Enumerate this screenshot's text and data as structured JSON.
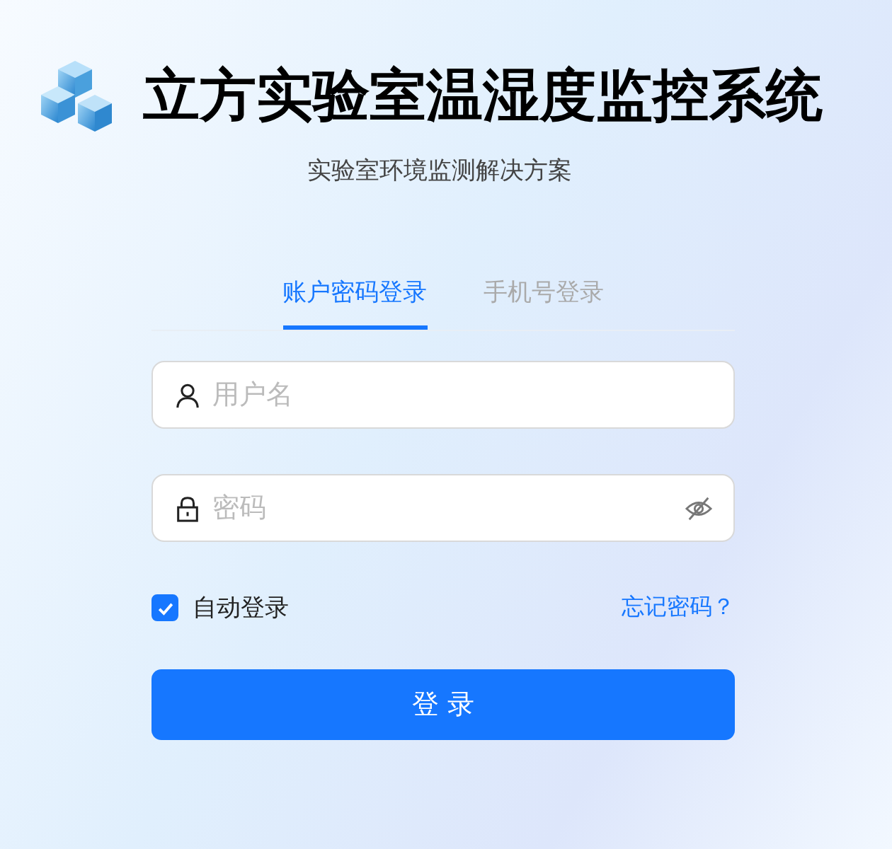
{
  "header": {
    "title": "立方实验室温湿度监控系统",
    "subtitle": "实验室环境监测解决方案"
  },
  "tabs": [
    {
      "label": "账户密码登录",
      "selected": true
    },
    {
      "label": "手机号登录",
      "selected": false
    }
  ],
  "fields": [
    {
      "kind": "username",
      "placeholder": "用户名"
    },
    {
      "kind": "password",
      "placeholder": "密码"
    }
  ],
  "remember": {
    "label": "自动登录",
    "checked": true
  },
  "forgot_link": "忘记密码？",
  "submit": "登 录"
}
